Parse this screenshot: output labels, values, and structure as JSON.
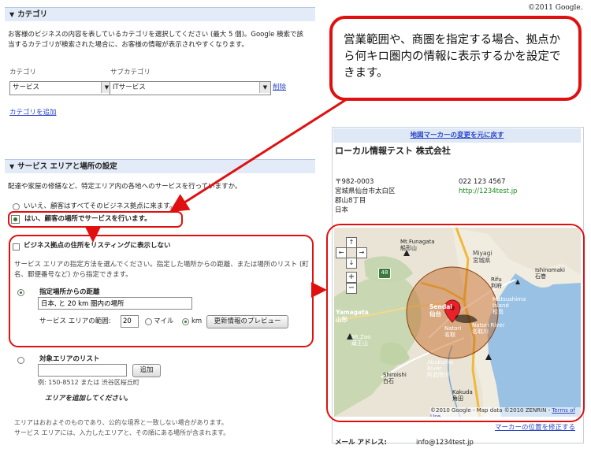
{
  "copyright": "©2011 Google.",
  "category_section": {
    "title": "カテゴリ",
    "description": "お客様のビジネスの内容を表しているカテゴリを選択してください (最大 5 個)。Google 検索で該当するカテゴリが検索された場合に、お客様の情報が表示されやすくなります。",
    "category_label": "カテゴリ",
    "subcategory_label": "サブカテゴリ",
    "category_value": "サービス",
    "subcategory_value": "ITサービス",
    "delete_link": "削除",
    "add_category_link": "カテゴリを追加"
  },
  "callout": {
    "text": "営業範囲や、商圏を指定する場合、拠点から何キロ圏内の情報に表示するかを設定できます。"
  },
  "service_section": {
    "title": "サービス エリアと場所の設定",
    "question": "配達や家屋の修繕など、特定エリア内の各地へのサービスを行っていますか。",
    "option_no": "いいえ、顧客はすべてそのビジネス拠点に来ます。",
    "option_yes": "はい、顧客の場所でサービスを行います。",
    "hide_address_label": "ビジネス拠点の住所をリスティングに表示しない",
    "method_description": "サービス エリアの指定方法を選んでください。指定した場所からの距離、または場所のリスト (町名、郵便番号など) から指定できます。",
    "distance_option": "指定場所からの距離",
    "distance_input": "日本, と 20 km 圏内の場所",
    "range_label": "サービス エリアの範囲:",
    "range_value": "20",
    "unit_miles": "マイル",
    "unit_km": "km",
    "preview_button": "更新情報のプレビュー",
    "list_option": "対象エリアのリスト",
    "add_button": "追加",
    "list_example": "例: 150-8512 または 渋谷区桜丘町",
    "add_area_prompt": "エリアを追加してください。",
    "note_1": "エリアはおおよそのものであり、公的な境界と一致しない場合があります。",
    "note_2": "サービス エリアには、入力したエリアと、その順にある場所が含まれます。"
  },
  "listing": {
    "reset_marker_link": "地図マーカーの変更を元に戻す",
    "business_name": "ローカル情報テスト 株式会社",
    "address_lines": [
      "〒982-0003",
      "宮城県仙台市太白区",
      "郡山8丁目",
      "日本"
    ],
    "phone": "022 123 4567",
    "url": "http://1234test.jp",
    "fix_marker_link": "マーカーの位置を修正する",
    "email_label": "メール アドレス:",
    "email_value": "info@1234test.jp"
  },
  "map": {
    "zoom_in": "+",
    "zoom_out": "−",
    "road_number": "48",
    "attribution": "©2010 Google - Map data ©2010 ZENRIN -",
    "terms_link": "Terms of Use",
    "places": {
      "funagata": "Mt.Funagata\n船形山",
      "miyagi": "Miyagi\n宮城県",
      "rifu": "Rifu\n利府",
      "ishinomaki": "Ishinomaki\n石巻",
      "sendai": "Sendai\n仙台",
      "matsushima": "Matsushima\nIsland\n松島",
      "yamagata": "Yamagata\n山形",
      "natori_river": "Natori River\n名取川",
      "natori": "Natori\n名取",
      "zao": "Mt.Zao\n蔵王山",
      "abukuma": "Abukuma\nRiver\n阿武隈川",
      "shiroishi": "Shiroishi\n白石",
      "kakuda": "Kakuda\n角田"
    }
  },
  "colors": {
    "highlight_red": "#e01010",
    "link_blue": "#2a44c8",
    "url_green": "#1a8a1a",
    "section_header_bg": "#e2ebf7",
    "service_circle": "#c4621a"
  }
}
